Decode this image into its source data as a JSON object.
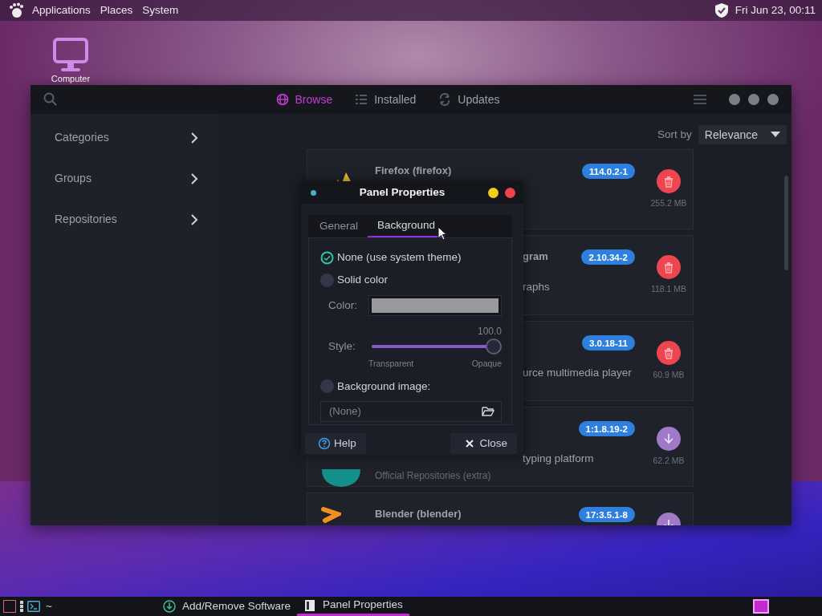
{
  "top_panel": {
    "menus": [
      "Applications",
      "Places",
      "System"
    ],
    "clock": "Fri Jun 23, 00:11"
  },
  "desktop_icons": [
    {
      "label": "Computer"
    }
  ],
  "app_window": {
    "tabs": [
      {
        "label": "Browse",
        "selected": true
      },
      {
        "label": "Installed",
        "selected": false
      },
      {
        "label": "Updates",
        "selected": false
      }
    ],
    "sidebar": [
      {
        "label": "Categories"
      },
      {
        "label": "Groups"
      },
      {
        "label": "Repositories"
      }
    ],
    "sort": {
      "label": "Sort by",
      "value": "Relevance"
    },
    "packages": [
      {
        "lines": [
          {
            "kind": "title",
            "text": "Firefox (firefox)"
          }
        ],
        "version": "114.0.2-1",
        "kind": "remove",
        "size": "255.2 MB"
      },
      {
        "lines": [
          {
            "kind": "title-tail",
            "text": "gram"
          },
          {
            "kind": "text-tail",
            "text": "raphs"
          }
        ],
        "version": "2.10.34-2",
        "kind": "remove",
        "size": "118.1 MB"
      },
      {
        "lines": [
          {
            "kind": "text-tail",
            "text": "urce multimedia player"
          }
        ],
        "version": "3.0.18-11",
        "kind": "remove",
        "size": "60.9 MB"
      },
      {
        "lines": [
          {
            "kind": "text-tail",
            "text": "typing platform"
          },
          {
            "kind": "repo",
            "text": "Official Repositories (extra)"
          }
        ],
        "version": "1:1.8.19-2",
        "kind": "install",
        "size": "62.2 MB"
      },
      {
        "lines": [
          {
            "kind": "title",
            "text": "Blender (blender)"
          }
        ],
        "version": "17:3.5.1-8",
        "kind": "install"
      }
    ]
  },
  "dialog": {
    "title": "Panel Properties",
    "tabs": [
      {
        "label": "General",
        "selected": false
      },
      {
        "label": "Background",
        "selected": true
      }
    ],
    "rows": [
      {
        "kind": "radio",
        "label": "None (use system theme)",
        "checked": true
      },
      {
        "kind": "radio",
        "label": "Solid color",
        "checked": false
      },
      {
        "kind": "color",
        "label": "Color:"
      },
      {
        "kind": "slider",
        "label": "Style:",
        "reading": "100.0",
        "level": 1.0,
        "min_label": "Transparent",
        "max_label": "Opaque"
      },
      {
        "kind": "radio",
        "label": "Background image:",
        "checked": false
      },
      {
        "kind": "file",
        "placeholder": "(None)"
      }
    ],
    "buttons": [
      {
        "kind": "help",
        "label": "Help"
      },
      {
        "kind": "close",
        "label": "Close"
      }
    ]
  },
  "taskbar": {
    "terminal_label": "~",
    "tasks": [
      {
        "kind": "software",
        "label": "Add/Remove Software",
        "selected": false
      },
      {
        "kind": "panel",
        "label": "Panel Properties",
        "selected": true
      }
    ]
  }
}
